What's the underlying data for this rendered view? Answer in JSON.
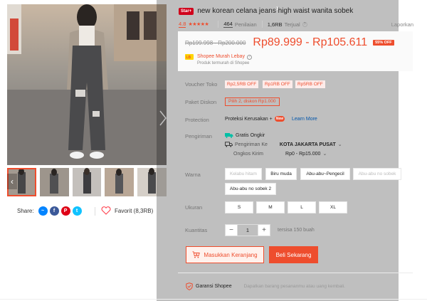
{
  "product": {
    "badge": "Star+",
    "title": "new korean celana jeans high waist wanita sobek"
  },
  "meta": {
    "rating": "4.8",
    "stars": "★★★★★",
    "reviews_count": "464",
    "reviews_label": "Penilaian",
    "sold_count": "1,6RB",
    "sold_label": "Terjual",
    "report_label": "Laporkan"
  },
  "price": {
    "original": "Rp199.998 - Rp200.000",
    "current": "Rp89.999 - Rp105.611",
    "discount": "55% OFF"
  },
  "seller": {
    "name": "Shopee Murah Lebay",
    "subtitle": "Produk termurah di Shopee"
  },
  "labels": {
    "voucher": "Voucher Toko",
    "paket": "Paket Diskon",
    "protection": "Protection",
    "shipping": "Pengiriman",
    "color": "Warna",
    "size": "Ukuran",
    "quantity": "Kuantitas"
  },
  "vouchers": [
    "Rp2,5RB OFF",
    "Rp1RB OFF",
    "Rp5RB OFF"
  ],
  "paket_offer": "Pilih 2, diskon Rp1.000",
  "protection": {
    "text": "Proteksi Kerusakan +",
    "new_badge": "New",
    "learn_more": "Learn More"
  },
  "shipping": {
    "free": "Gratis Ongkir",
    "to_label": "Pengiriman Ke",
    "to_value": "KOTA JAKARTA PUSAT",
    "cost_label": "Ongkos Kirim",
    "cost_value": "Rp0 - Rp15.000"
  },
  "colors": [
    "Kelabu hitam",
    "Biru muda",
    "Abu-abu~Pengecil",
    "Abu-abu no sobek",
    "Abu-abu no sobek 2"
  ],
  "sizes": [
    "S",
    "M",
    "L",
    "XL"
  ],
  "quantity": {
    "value": "1",
    "stock": "tersisa 150 buah"
  },
  "actions": {
    "add_to_cart": "Masukkan Keranjang",
    "buy_now": "Beli Sekarang"
  },
  "guarantee": {
    "title": "Garansi Shopee",
    "desc": "Dapatkan barang pesananmu atau uang kembali."
  },
  "share": {
    "label": "Share:",
    "favorite": "Favorit (8,3RB)"
  },
  "colors_theme": {
    "accent": "#ee4d2d",
    "link": "#0055aa",
    "free_shipping": "#00bfa5"
  }
}
